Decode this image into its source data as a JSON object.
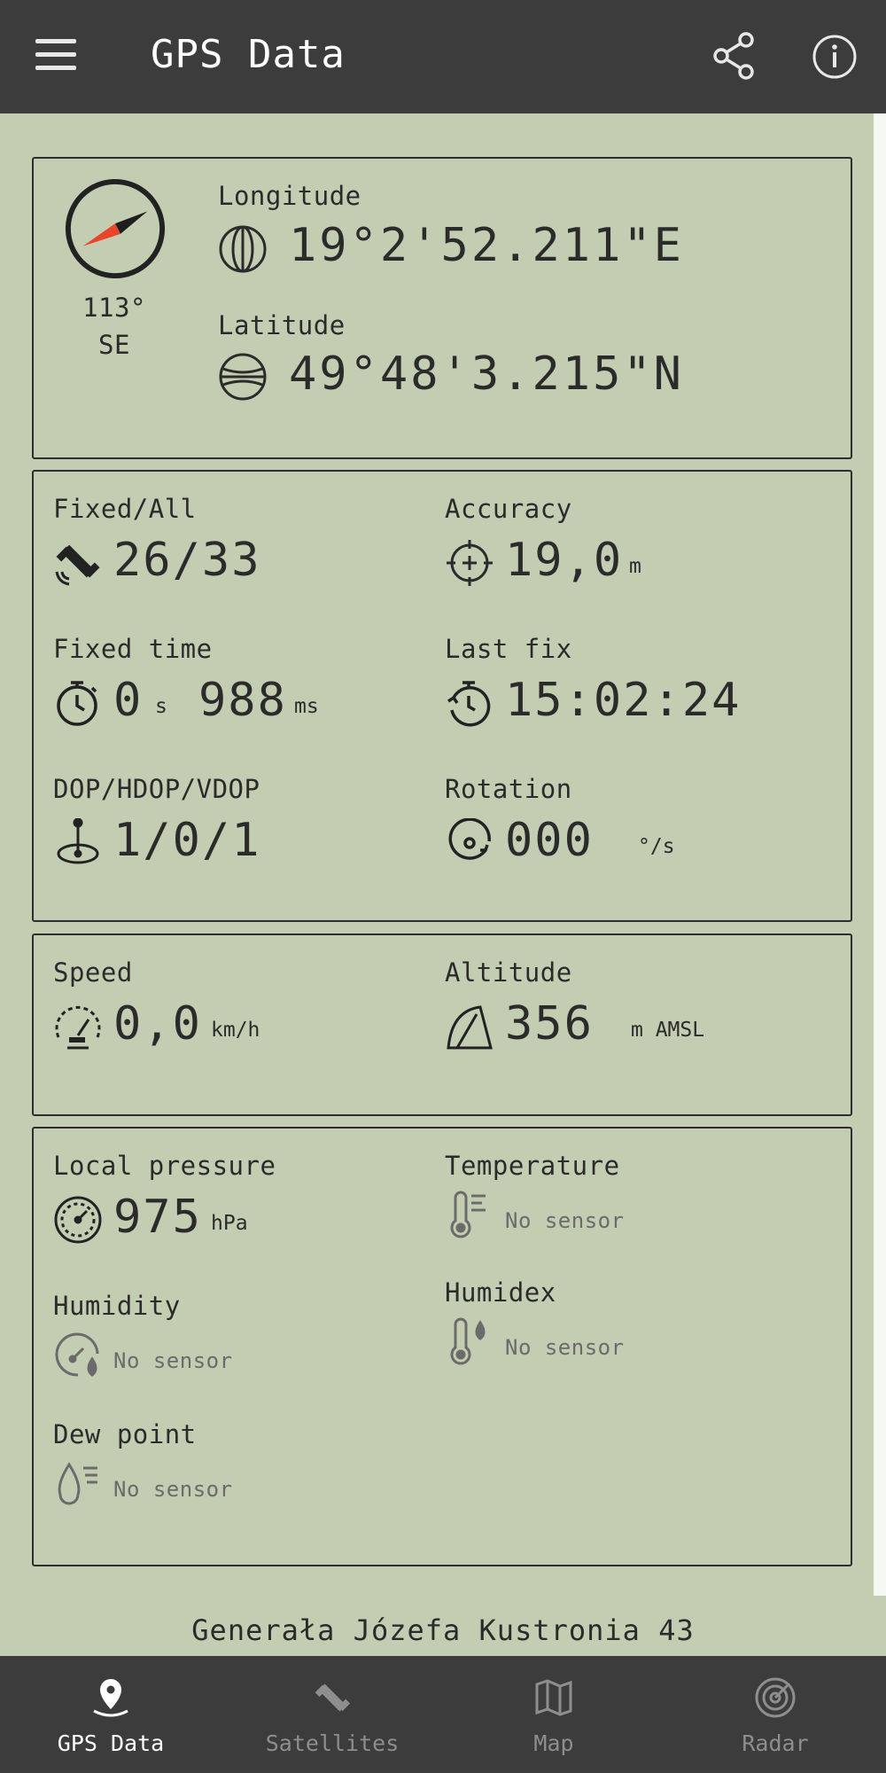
{
  "app": {
    "title": "GPS Data"
  },
  "compass": {
    "heading": "113°",
    "direction": "SE"
  },
  "location": {
    "longitude_label": "Longitude",
    "longitude_value": "19°2'52.211\"E",
    "latitude_label": "Latitude",
    "latitude_value": "49°48'3.215\"N"
  },
  "fix": {
    "fixed_all_label": "Fixed/All",
    "fixed_all_value": "26/33",
    "accuracy_label": "Accuracy",
    "accuracy_value": "19,0",
    "accuracy_unit": "m",
    "fixed_time_label": "Fixed time",
    "fixed_time_seconds": "0",
    "fixed_time_seconds_unit": "s",
    "fixed_time_ms": "988",
    "fixed_time_ms_unit": "ms",
    "last_fix_label": "Last fix",
    "last_fix_value": "15:02:24",
    "dop_label": "DOP/HDOP/VDOP",
    "dop_value": "1/0/1",
    "rotation_label": "Rotation",
    "rotation_value": "000",
    "rotation_unit": "°/s"
  },
  "motion": {
    "speed_label": "Speed",
    "speed_value": "0,0",
    "speed_unit": "km/h",
    "altitude_label": "Altitude",
    "altitude_value": "356",
    "altitude_unit": "m AMSL"
  },
  "environment": {
    "pressure_label": "Local pressure",
    "pressure_value": "975",
    "pressure_unit": "hPa",
    "temperature_label": "Temperature",
    "temperature_value": "No sensor",
    "humidity_label": "Humidity",
    "humidity_value": "No sensor",
    "humidex_label": "Humidex",
    "humidex_value": "No sensor",
    "dewpoint_label": "Dew point",
    "dewpoint_value": "No sensor"
  },
  "address": "Generała Józefa Kustronia 43",
  "nav": {
    "tabs": [
      {
        "label": "GPS Data",
        "icon": "location-pin-icon",
        "active": true
      },
      {
        "label": "Satellites",
        "icon": "satellite-icon",
        "active": false
      },
      {
        "label": "Map",
        "icon": "map-icon",
        "active": false
      },
      {
        "label": "Radar",
        "icon": "radar-icon",
        "active": false
      }
    ]
  },
  "colors": {
    "background": "#c3cdb2",
    "bar": "#3c3c3c",
    "compass_needle": "#e8452a",
    "text": "#2b2b2b",
    "muted": "#6b6b6b"
  }
}
